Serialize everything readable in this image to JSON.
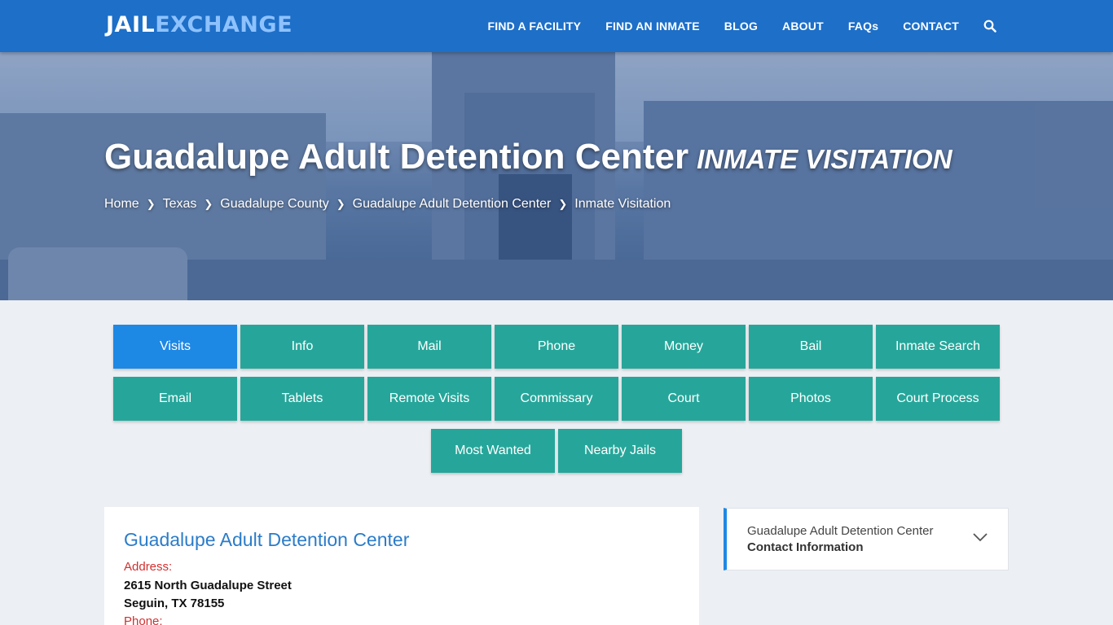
{
  "header": {
    "logo_part1": "JAIL",
    "logo_part2": "EXCHANGE",
    "nav": [
      "FIND A FACILITY",
      "FIND AN INMATE",
      "BLOG",
      "ABOUT",
      "FAQs",
      "CONTACT"
    ],
    "search_icon": "search-icon"
  },
  "hero": {
    "title": "Guadalupe Adult Detention Center",
    "subtitle": "INMATE VISITATION",
    "breadcrumbs": [
      "Home",
      "Texas",
      "Guadalupe County",
      "Guadalupe Adult Detention Center",
      "Inmate Visitation"
    ]
  },
  "buttons": {
    "row1": [
      "Visits",
      "Info",
      "Mail",
      "Phone",
      "Money",
      "Bail",
      "Inmate Search"
    ],
    "row2": [
      "Email",
      "Tablets",
      "Remote Visits",
      "Commissary",
      "Court",
      "Photos",
      "Court Process"
    ],
    "row3": [
      "Most Wanted",
      "Nearby Jails"
    ],
    "active": "Visits"
  },
  "card": {
    "title": "Guadalupe Adult Detention Center",
    "address_label": "Address:",
    "address_line1": "2615 North Guadalupe Street",
    "address_line2": "Seguin, TX 78155",
    "phone_label": "Phone:"
  },
  "sidebar": {
    "line1": "Guadalupe Adult Detention Center",
    "line2": "Contact Information",
    "icon": "chevron-down-icon"
  },
  "colors": {
    "header_blue": "#1d6fc8",
    "button_teal": "#26a69a",
    "button_active": "#1e88e5",
    "title_blue": "#2b7cc9",
    "label_red": "#d32f2f"
  }
}
